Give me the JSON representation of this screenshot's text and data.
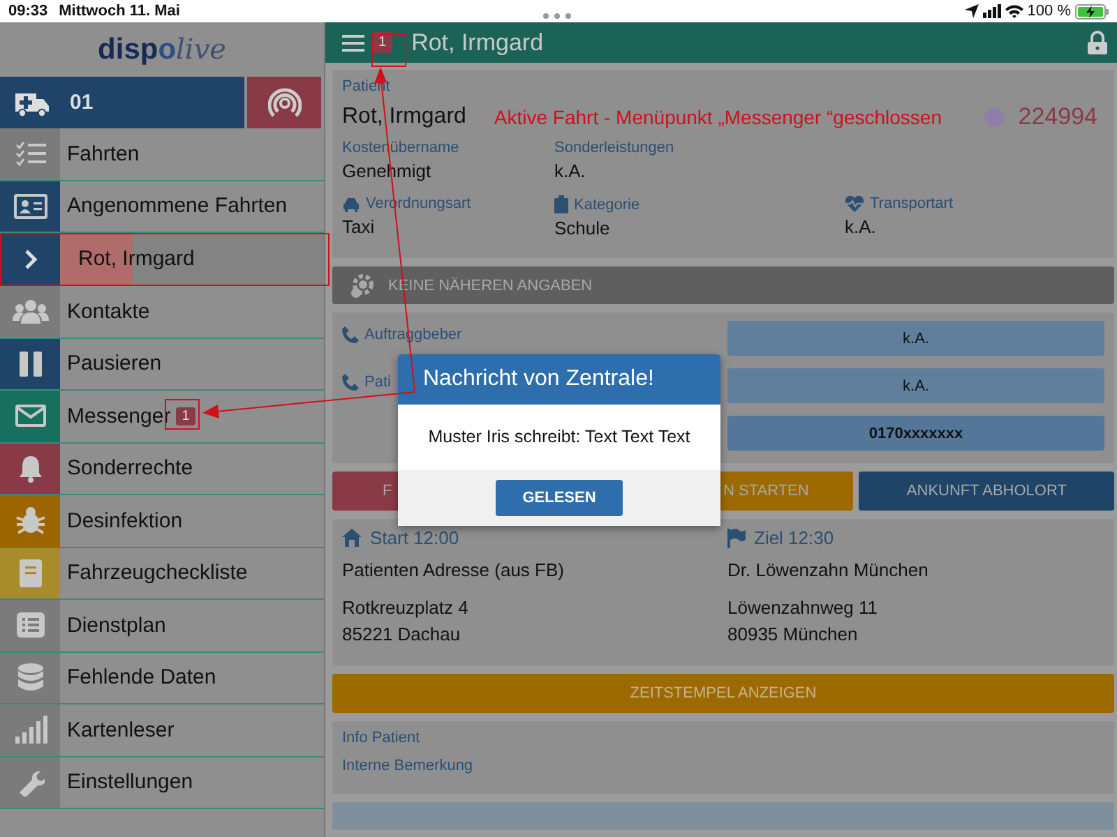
{
  "status_bar": {
    "time": "09:33",
    "date": "Mittwoch 11. Mai",
    "battery": "100 %"
  },
  "sidebar": {
    "logo": [
      "disp",
      "o",
      "live"
    ],
    "vehicle": "01",
    "items": [
      {
        "kind": "item",
        "label": "Fahrten",
        "color": "#7b7b7b"
      },
      {
        "kind": "item",
        "label": "Angenommene Fahrten",
        "color": "#1f4468"
      },
      {
        "kind": "subitem",
        "label": "Rot, Irmgard",
        "color": "#1f4468"
      },
      {
        "kind": "item",
        "label": "Kontakte",
        "color": "#7b7b7b"
      },
      {
        "kind": "item",
        "label": "Pausieren",
        "color": "#1f4468"
      },
      {
        "kind": "item",
        "label": "Messenger",
        "color": "#17705e",
        "badge": "1"
      },
      {
        "kind": "item",
        "label": "Sonderrechte",
        "color": "#8a3a47"
      },
      {
        "kind": "item",
        "label": "Desinfektion",
        "color": "#9c6500"
      },
      {
        "kind": "item",
        "label": "Fahrzeugcheckliste",
        "color": "#a88c2c"
      },
      {
        "kind": "item",
        "label": "Dienstplan",
        "color": "#7b7b7b"
      },
      {
        "kind": "item",
        "label": "Fehlende Daten",
        "color": "#7b7b7b"
      },
      {
        "kind": "item",
        "label": "Kartenleser",
        "color": "#7b7b7b"
      },
      {
        "kind": "item",
        "label": "Einstellungen",
        "color": "#7b7b7b"
      }
    ]
  },
  "header": {
    "badge": "1",
    "title": "Rot, Irmgard"
  },
  "patient": {
    "label": "Patient",
    "name": "Rot, Irmgard",
    "note": "Aktive Fahrt - Menüpunkt „Messenger “geschlossen",
    "number": "224994",
    "field_rows": [
      [
        {
          "label": "Kostenübername",
          "value": "Genehmigt"
        },
        {
          "label": "Sonderleistungen",
          "value": "k.A."
        }
      ],
      [
        {
          "label": "Verordnungsart",
          "value": "Taxi"
        },
        {
          "label": "Kategorie",
          "value": "Schule"
        },
        {
          "label": "Transportart",
          "value": "k.A."
        }
      ]
    ]
  },
  "details_bar": "KEINE NÄHEREN ANGABEN",
  "contacts": [
    {
      "label": "Auftraggbeber",
      "value": "k.A."
    },
    {
      "label": "Pati",
      "value": "k.A."
    },
    {
      "value": "0170xxxxxxx"
    }
  ],
  "actions": [
    {
      "label": "F",
      "color": "#8a3a47"
    },
    {
      "label": "N STARTEN",
      "color": "#9c6a00"
    },
    {
      "label": "ANKUNFT ABHOLORT",
      "color": "#1f4468"
    }
  ],
  "route": [
    {
      "heading": "Start 12:00",
      "name": "Patienten Adresse (aus FB)",
      "street": "Rotkreuzplatz 4",
      "city": "85221 Dachau"
    },
    {
      "heading": "Ziel 12:30",
      "name": "Dr. Löwenzahn München",
      "street": "Löwenzahnweg 11",
      "city": "80935 München"
    }
  ],
  "timestamp_button": "ZEITSTEMPEL ANZEIGEN",
  "info": [
    "Info Patient",
    "Interne Bemerkung"
  ],
  "dialog": {
    "title": "Nachricht von Zentrale!",
    "message": "Muster Iris schreibt: Text Text Text",
    "button": "GELESEN"
  }
}
